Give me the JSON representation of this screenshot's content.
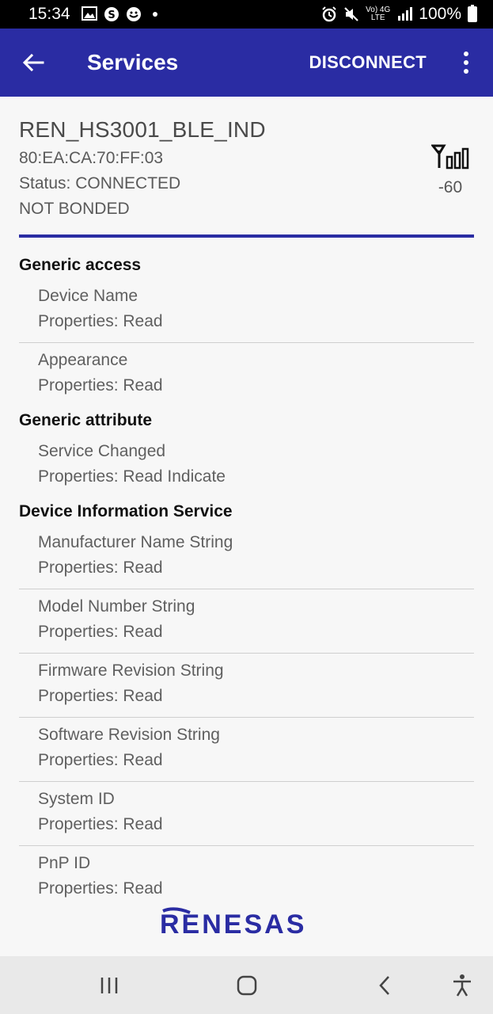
{
  "status_bar": {
    "time": "15:34",
    "battery_percent": "100%",
    "network_label_top": "Vo) 4G",
    "network_label_bottom": "LTE"
  },
  "app_bar": {
    "title": "Services",
    "disconnect_label": "DISCONNECT",
    "color": "#2a2ca3"
  },
  "device": {
    "name": "REN_HS3001_BLE_IND",
    "address": "80:EA:CA:70:FF:03",
    "status": "Status:  CONNECTED",
    "bond": "NOT BONDED",
    "rssi": "-60"
  },
  "services": [
    {
      "title": "Generic access",
      "characteristics": [
        {
          "name": "Device Name",
          "properties": "Properties: Read"
        },
        {
          "name": "Appearance",
          "properties": "Properties: Read"
        }
      ]
    },
    {
      "title": "Generic attribute",
      "characteristics": [
        {
          "name": "Service Changed",
          "properties": "Properties: Read Indicate"
        }
      ]
    },
    {
      "title": "Device Information Service",
      "characteristics": [
        {
          "name": "Manufacturer Name String",
          "properties": "Properties: Read"
        },
        {
          "name": "Model Number String",
          "properties": "Properties: Read"
        },
        {
          "name": "Firmware Revision String",
          "properties": "Properties: Read"
        },
        {
          "name": "Software Revision String",
          "properties": "Properties: Read"
        },
        {
          "name": "System ID",
          "properties": "Properties: Read"
        },
        {
          "name": "PnP ID",
          "properties": "Properties: Read"
        }
      ]
    }
  ],
  "logo": {
    "text": "RENESAS",
    "color": "#2a2ca3"
  }
}
